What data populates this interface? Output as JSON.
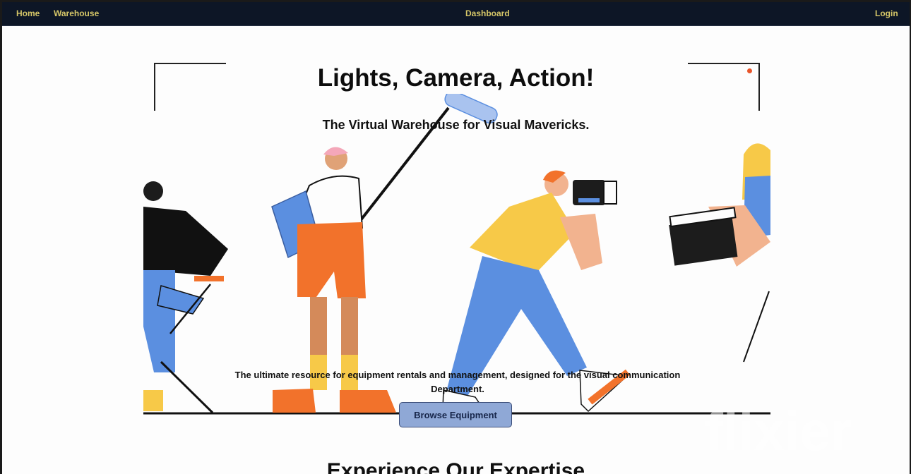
{
  "nav": {
    "home": "Home",
    "warehouse": "Warehouse",
    "dashboard": "Dashboard",
    "login": "Login"
  },
  "hero": {
    "title": "Lights, Camera, Action!",
    "subtitle": "The Virtual Warehouse for Visual Mavericks.",
    "description": "The ultimate resource for equipment rentals and management, designed for the visual communication Department.",
    "button_label": "Browse Equipment"
  },
  "section": {
    "heading": "Experience Our Expertise"
  },
  "watermark": {
    "text": "flixier"
  },
  "colors": {
    "nav_bg": "#0d1626",
    "nav_link": "#d6c768",
    "button_bg": "#8fa8d6",
    "accent_orange": "#f2722b",
    "accent_blue": "#5b8fe0",
    "accent_yellow": "#f7c948"
  }
}
